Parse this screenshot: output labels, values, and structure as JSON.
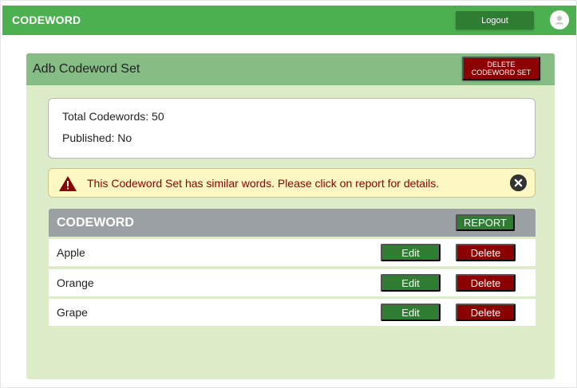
{
  "header": {
    "brand": "CODEWORD",
    "logout_label": "Logout",
    "avatar_icon": "user-avatar-icon",
    "bar_color": "#4caf50"
  },
  "card": {
    "title": "Adb Codeword Set",
    "delete_set_label": "DELETE CODEWORD SET",
    "info": {
      "total_codewords": "Total Codewords: 50",
      "published": "Published: No"
    },
    "alert": {
      "icon": "warning-triangle-icon",
      "message": "This Codeword Set has similar words. Please click on report for details.",
      "close_icon": "close-circle-icon"
    },
    "table": {
      "column_header": "CODEWORD",
      "report_label": "REPORT",
      "rows": [
        {
          "word": "Apple",
          "edit_label": "Edit",
          "delete_label": "Delete"
        },
        {
          "word": "Orange",
          "edit_label": "Edit",
          "delete_label": "Delete"
        },
        {
          "word": "Grape",
          "edit_label": "Edit",
          "delete_label": "Delete"
        }
      ]
    }
  },
  "colors": {
    "accent_green": "#2e7d32",
    "danger_red": "#8b0000",
    "panel_bg": "#dcecc8",
    "panel_header": "#85bd85",
    "alert_bg": "#fdf7c3"
  }
}
